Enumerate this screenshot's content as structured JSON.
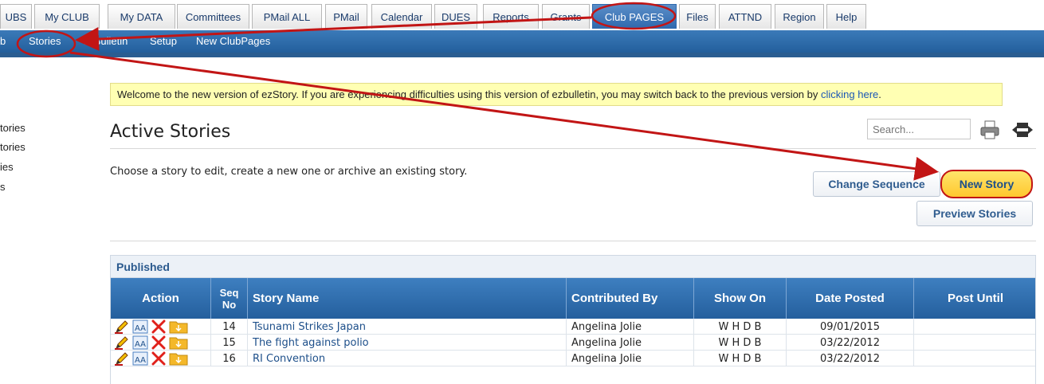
{
  "tabs": [
    {
      "label": "UBS",
      "active": false
    },
    {
      "label": "My CLUB",
      "active": false
    },
    {
      "label": "My DATA",
      "active": false
    },
    {
      "label": "Committees",
      "active": false
    },
    {
      "label": "PMail ALL",
      "active": false
    },
    {
      "label": "PMail",
      "active": false
    },
    {
      "label": "Calendar",
      "active": false
    },
    {
      "label": "DUES",
      "active": false
    },
    {
      "label": "Reports",
      "active": false
    },
    {
      "label": "Grants",
      "active": false
    },
    {
      "label": "Club PAGES",
      "active": true
    },
    {
      "label": "Files",
      "active": false
    },
    {
      "label": "ATTND",
      "active": false
    },
    {
      "label": "Region",
      "active": false
    },
    {
      "label": "Help",
      "active": false
    }
  ],
  "subnav": [
    {
      "label": "b"
    },
    {
      "label": "Stories"
    },
    {
      "label": "ezBulletin"
    },
    {
      "label": "Setup"
    },
    {
      "label": "New ClubPages"
    }
  ],
  "side_menu": [
    {
      "label": "tories"
    },
    {
      "label": "tories"
    },
    {
      "label": "ies"
    },
    {
      "label": "s"
    }
  ],
  "banner": {
    "text": "Welcome to the new version of ezStory. If you are experiencing difficulties using this version of ezbulletin, you may switch back to the previous version by ",
    "link": "clicking here",
    "suffix": "."
  },
  "page": {
    "title": "Active Stories",
    "description": "Choose a story to edit, create a new one or archive an existing story."
  },
  "search": {
    "placeholder": "Search..."
  },
  "buttons": {
    "change_sequence": "Change Sequence",
    "new_story": "New Story",
    "preview_stories": "Preview Stories"
  },
  "table": {
    "section": "Published",
    "headers": {
      "action": "Action",
      "seq_line1": "Seq",
      "seq_line2": "No",
      "story_name": "Story Name",
      "contributed_by": "Contributed By",
      "show_on": "Show On",
      "date_posted": "Date Posted",
      "post_until": "Post Until"
    },
    "rows": [
      {
        "seq": "14",
        "name": "Tsunami Strikes Japan",
        "contributor": "Angelina Jolie",
        "show_on": "W H D B",
        "date": "09/01/2015",
        "until": ""
      },
      {
        "seq": "15",
        "name": "The fight against polio",
        "contributor": "Angelina Jolie",
        "show_on": "W H D B",
        "date": "03/22/2012",
        "until": ""
      },
      {
        "seq": "16",
        "name": "RI Convention",
        "contributor": "Angelina Jolie",
        "show_on": "W H D B",
        "date": "03/22/2012",
        "until": ""
      }
    ]
  },
  "colors": {
    "accent": "#2f69ad",
    "annotation": "#c21515",
    "highlight": "#ffc72e"
  }
}
